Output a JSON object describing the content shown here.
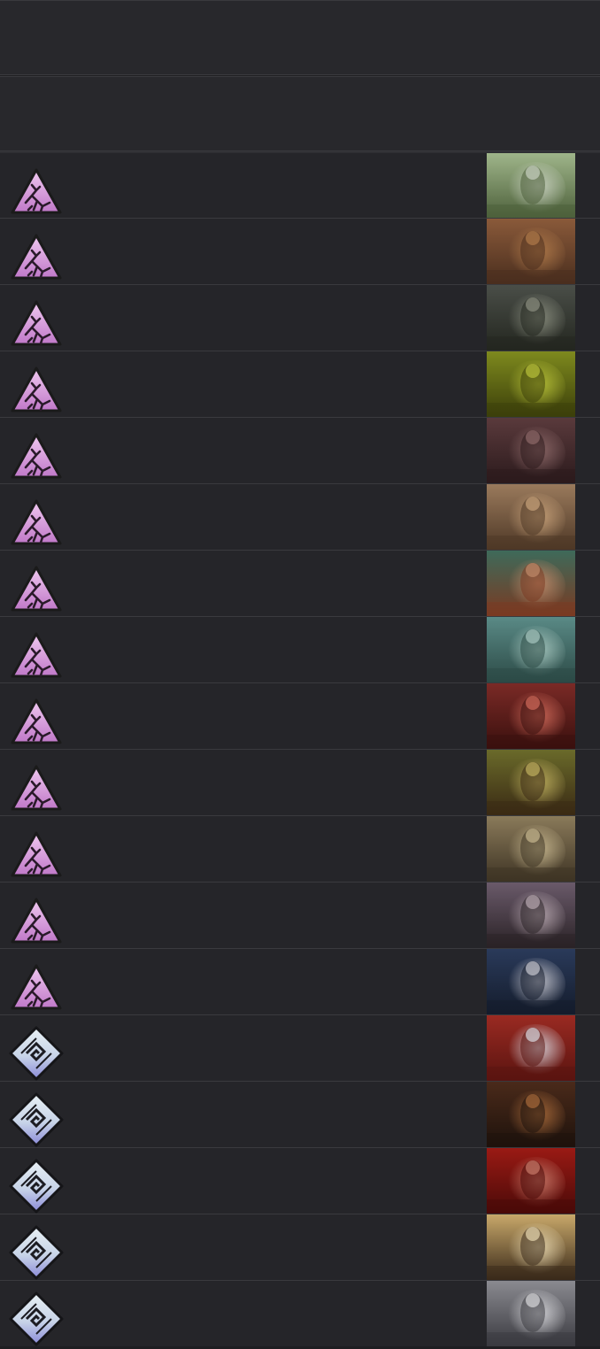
{
  "header": {
    "title": "",
    "subtitle": ""
  },
  "cards": [
    {
      "set_icon": "cracked-triangle-icon",
      "art": "goblin-art",
      "colors": [
        "#9fb58a",
        "#4c5f3a",
        "#c8d0c0"
      ]
    },
    {
      "set_icon": "cracked-triangle-icon",
      "art": "beast-in-mud-art",
      "colors": [
        "#8a5a3a",
        "#4a2e1e",
        "#b07a4a"
      ]
    },
    {
      "set_icon": "cracked-triangle-icon",
      "art": "dark-forest-warriors-art",
      "colors": [
        "#4a4e48",
        "#23261f",
        "#8b8f80"
      ]
    },
    {
      "set_icon": "cracked-triangle-icon",
      "art": "green-eggs-art",
      "colors": [
        "#7e8a1e",
        "#3c3f0a",
        "#b9c23a"
      ]
    },
    {
      "set_icon": "cracked-triangle-icon",
      "art": "hooded-figure-art",
      "colors": [
        "#5a3a3c",
        "#2b1a1c",
        "#8e6a6a"
      ]
    },
    {
      "set_icon": "cracked-triangle-icon",
      "art": "dwarf-warrior-art",
      "colors": [
        "#9a7a5c",
        "#4e3826",
        "#c8a27a"
      ]
    },
    {
      "set_icon": "cracked-triangle-icon",
      "art": "tribal-warrior-art",
      "colors": [
        "#3e6a5a",
        "#7a3a22",
        "#c08a6a"
      ]
    },
    {
      "set_icon": "cracked-triangle-icon",
      "art": "misty-soldier-art",
      "colors": [
        "#5a8a86",
        "#2c4a46",
        "#a8c8c0"
      ]
    },
    {
      "set_icon": "cracked-triangle-icon",
      "art": "red-mech-art",
      "colors": [
        "#7a2a26",
        "#3a100e",
        "#d06a5a"
      ]
    },
    {
      "set_icon": "cracked-triangle-icon",
      "art": "armored-brute-art",
      "colors": [
        "#6a6a2a",
        "#3a2a14",
        "#c0b060"
      ]
    },
    {
      "set_icon": "cracked-triangle-icon",
      "art": "boar-rider-art",
      "colors": [
        "#8a7a5a",
        "#3e3424",
        "#c8b890"
      ]
    },
    {
      "set_icon": "cracked-triangle-icon",
      "art": "hat-adventurer-art",
      "colors": [
        "#6a5a6a",
        "#2a2226",
        "#b8a8b0"
      ]
    },
    {
      "set_icon": "cracked-triangle-icon",
      "art": "holy-knight-art",
      "colors": [
        "#2a3a5a",
        "#141c2c",
        "#c8c8d0"
      ]
    },
    {
      "set_icon": "spiral-diamond-icon",
      "art": "charging-beast-art",
      "colors": [
        "#9a2a22",
        "#5a1410",
        "#d8d8e0"
      ]
    },
    {
      "set_icon": "spiral-diamond-icon",
      "art": "tavern-dwarves-art",
      "colors": [
        "#4a2a1a",
        "#1e120c",
        "#a86a3a"
      ]
    },
    {
      "set_icon": "spiral-diamond-icon",
      "art": "cauldron-creature-art",
      "colors": [
        "#9a1a14",
        "#4a0a08",
        "#c87a6a"
      ]
    },
    {
      "set_icon": "spiral-diamond-icon",
      "art": "leaping-rogue-art",
      "colors": [
        "#c8a86a",
        "#3a2a1a",
        "#e8d8b0"
      ]
    },
    {
      "set_icon": "spiral-diamond-icon",
      "art": "silver-statue-art",
      "colors": [
        "#8a8a90",
        "#3a3a40",
        "#d8d8dc"
      ]
    }
  ]
}
